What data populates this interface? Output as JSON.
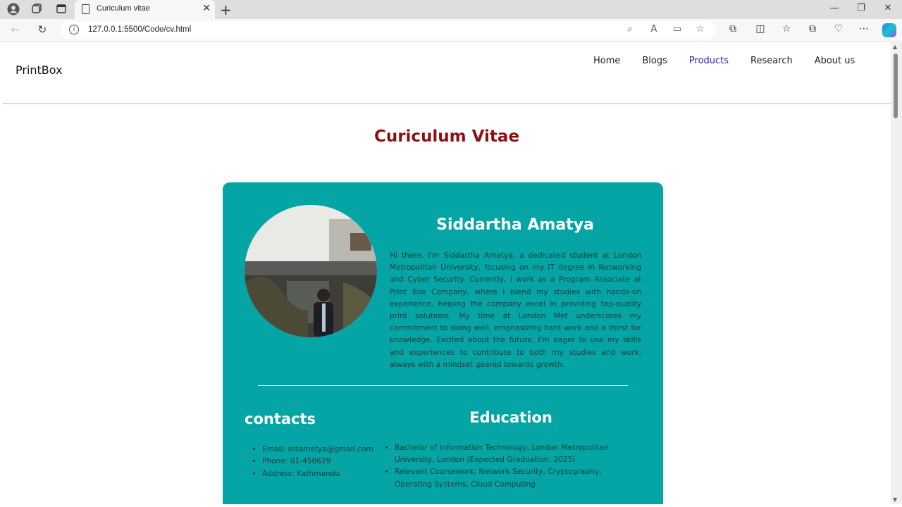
{
  "browser": {
    "tab_title": "Curiculum vitae",
    "url": "127.0.0.1:5500/Code/cv.html"
  },
  "site": {
    "logo": "PrintBox",
    "nav": [
      "Home",
      "Blogs",
      "Products",
      "Research",
      "About us"
    ],
    "active_nav": "Products",
    "page_title": "Curiculum Vitae"
  },
  "profile": {
    "name": "Siddartha Amatya",
    "bio": "Hi there, I'm Siddartha Amatya, a dedicated student at London Metropolitan University, focusing on my IT degree in Networking and Cyber Security. Currently, I work as a Program Associate at Print Box Company, where I blend my studies with hands-on experience, helping the company excel in providing top-quality print solutions. My time at London Met underscores my commitment to doing well, emphasizing hard work and a thirst for knowledge. Excited about the future, I'm eager to use my skills and experiences to contribute to both my studies and work, always with a mindset geared towards growth."
  },
  "contacts": {
    "heading": "contacts",
    "items": [
      "Email: sidamatya@gmail.com",
      "Phone: 01-458629",
      "Address: Kathmandu"
    ]
  },
  "education": {
    "heading": "Education",
    "items": [
      "Bachelor of Information Technology, London Metropolitan University, London (Expected Graduation: 2025)",
      "Relevant Coursework: Network Security, Cryptography, Operating Systems, Cloud Computing"
    ]
  },
  "colors": {
    "card": "#05a5a5",
    "title": "#8b1010",
    "active_nav": "#2a20a8"
  }
}
